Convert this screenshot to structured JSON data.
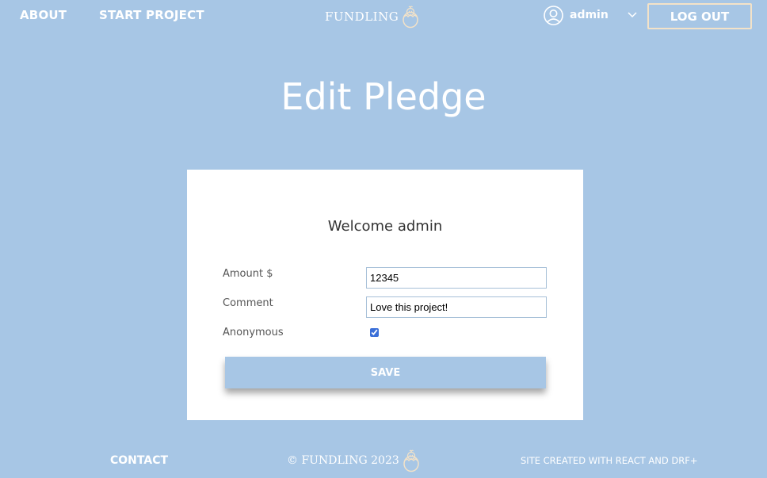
{
  "header": {
    "nav": {
      "about": "ABOUT",
      "start_project": "START PROJECT"
    },
    "logo": "FUNDLING",
    "user": {
      "name": "admin"
    },
    "logout": "LOG OUT"
  },
  "main": {
    "title": "Edit Pledge",
    "welcome": "Welcome admin",
    "form": {
      "amount": {
        "label": "Amount $",
        "value": "12345"
      },
      "comment": {
        "label": "Comment",
        "value": "Love this project!"
      },
      "anonymous": {
        "label": "Anonymous",
        "checked": true
      },
      "save": "SAVE"
    }
  },
  "footer": {
    "contact": "CONTACT",
    "copyright": "© FUNDLING 2023",
    "credit": "SITE CREATED WITH REACT AND DRF+"
  },
  "colors": {
    "background": "#a7c6e5",
    "accent_border": "#f3e2c8",
    "card": "#ffffff"
  },
  "icons": {
    "logo": "chick-egg-icon",
    "user": "user-circle-icon",
    "dropdown": "chevron-down-icon"
  }
}
